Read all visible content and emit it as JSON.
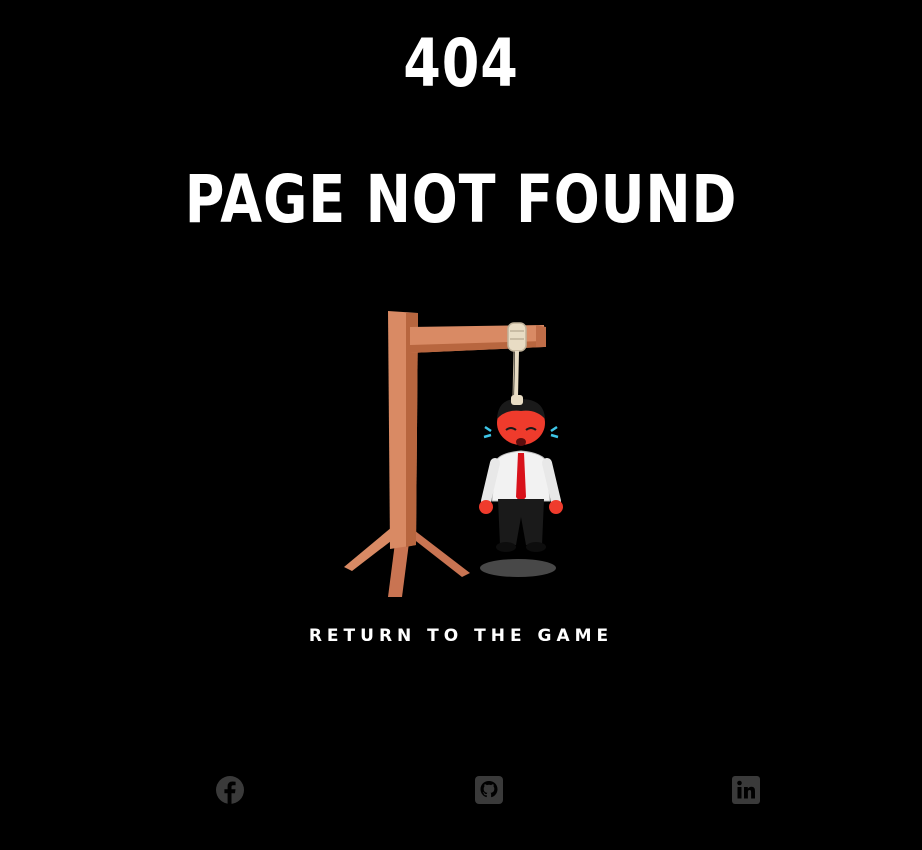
{
  "header": {
    "code": "404",
    "title": "PAGE NOT FOUND"
  },
  "illustration": {
    "description_icon": "hangman-icon"
  },
  "actions": {
    "return_label": "RETURN TO THE GAME"
  },
  "footer": {
    "social": [
      {
        "icon": "facebook-icon"
      },
      {
        "icon": "github-icon"
      },
      {
        "icon": "linkedin-icon"
      }
    ]
  },
  "colors": {
    "background": "#000000",
    "text": "#ffffff",
    "icon": "#3a3a3a",
    "wood": "#d98a64",
    "wood_dark": "#a85c3c",
    "rope": "#e8dcc4"
  }
}
